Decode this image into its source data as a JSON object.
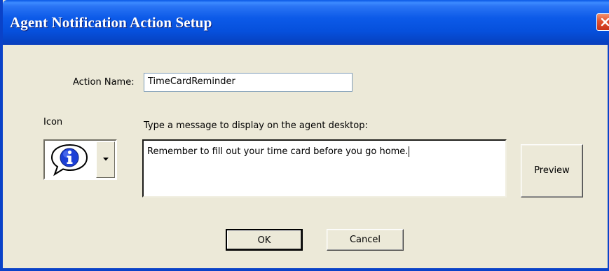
{
  "window": {
    "title": "Agent Notification Action Setup"
  },
  "form": {
    "action_name_label": "Action Name:",
    "action_name_value": "TimeCardReminder",
    "icon_label": "Icon",
    "icon_selected": "information-icon",
    "message_label": "Type a message to display on the agent desktop:",
    "message_value": "Remember to fill out your time card before you go home."
  },
  "buttons": {
    "preview": "Preview",
    "ok": "OK",
    "cancel": "Cancel"
  },
  "icons": {
    "close": "close-icon",
    "dropdown": "chevron-down-icon"
  },
  "colors": {
    "title_bar": "#0a58e6",
    "dialog_background": "#ece9d8",
    "close_button": "#e0512e"
  }
}
